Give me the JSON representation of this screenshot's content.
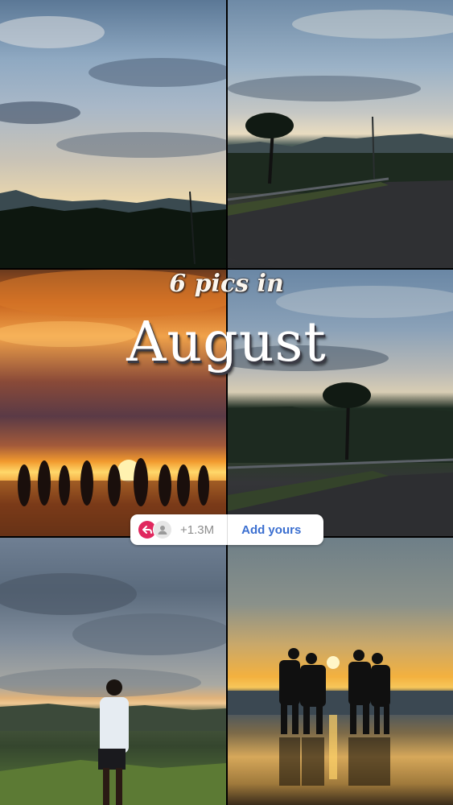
{
  "title": {
    "line1": "6 pics in",
    "line2": "August"
  },
  "photos": [
    {
      "name": "cloudy-sky-mountains"
    },
    {
      "name": "road-palm-tree"
    },
    {
      "name": "dancing-silhouettes-sunset"
    },
    {
      "name": "road-palm-tree-2"
    },
    {
      "name": "person-on-hill"
    },
    {
      "name": "friends-beach-sunset"
    }
  ],
  "add_yours": {
    "count": "+1.3M",
    "button_label": "Add yours"
  },
  "colors": {
    "accent": "#e0285e",
    "link": "#3b6fd0"
  }
}
